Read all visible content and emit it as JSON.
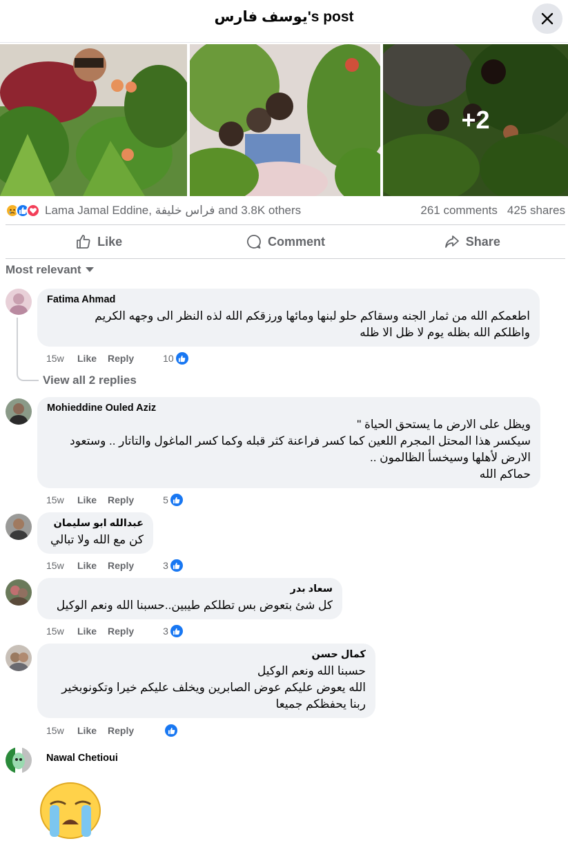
{
  "header": {
    "title": "يوسف فارس's post"
  },
  "photos": {
    "more_count": "+2"
  },
  "reactions": {
    "names": "Lama Jamal Eddine, فراس خليفة and 3.8K others",
    "comments": "261 comments",
    "shares": "425 shares"
  },
  "actions": {
    "like": "Like",
    "comment": "Comment",
    "share": "Share"
  },
  "filter": {
    "label": "Most relevant"
  },
  "comments": [
    {
      "name": "Fatima Ahmad",
      "text": "اطعمكم الله من ثمار الجنه وسقاكم حلو لبنها ومائها ورزقكم الله لذه النظر الى وجهه الكريم\nواظلكم الله بظله يوم لا ظل الا ظله",
      "time": "15w",
      "like": "Like",
      "reply": "Reply",
      "likes": "10"
    },
    {
      "name": "Mohieddine Ouled Aziz",
      "text": "ويظل على الارض ما يستحق الحياة \"\nسيكسر هذا المحتل المجرم اللعين كما كسر فراعنة كثر قبله وكما كسر الماغول والتاتار .. وستعود\nالارض لأهلها وسيخسأ الظالمون ..\nحماكم الله",
      "time": "15w",
      "like": "Like",
      "reply": "Reply",
      "likes": "5"
    },
    {
      "name": "عبدالله ابو سليمان",
      "text": "كن مع الله ولا تبالي",
      "time": "15w",
      "like": "Like",
      "reply": "Reply",
      "likes": "3"
    },
    {
      "name": "سعاد بدر",
      "text": "كل شئ بتعوض بس تطلكم طيبين..حسبنا الله ونعم الوكيل",
      "time": "15w",
      "like": "Like",
      "reply": "Reply",
      "likes": "3"
    },
    {
      "name": "كمال حسن",
      "text": "حسبنا الله ونعم الوكيل\nالله يعوض عليكم عوض الصابرين ويخلف عليكم خيرا وتكونوبخير\nربنا يحفظكم جميعا",
      "time": "15w",
      "like": "Like",
      "reply": "Reply",
      "likes": ""
    },
    {
      "name": "Nawal Chetioui"
    }
  ],
  "view_replies": "View all 2 replies",
  "colors": {
    "accent": "#1877f2",
    "secondary_text": "#65676b",
    "bubble": "#f0f2f5"
  }
}
